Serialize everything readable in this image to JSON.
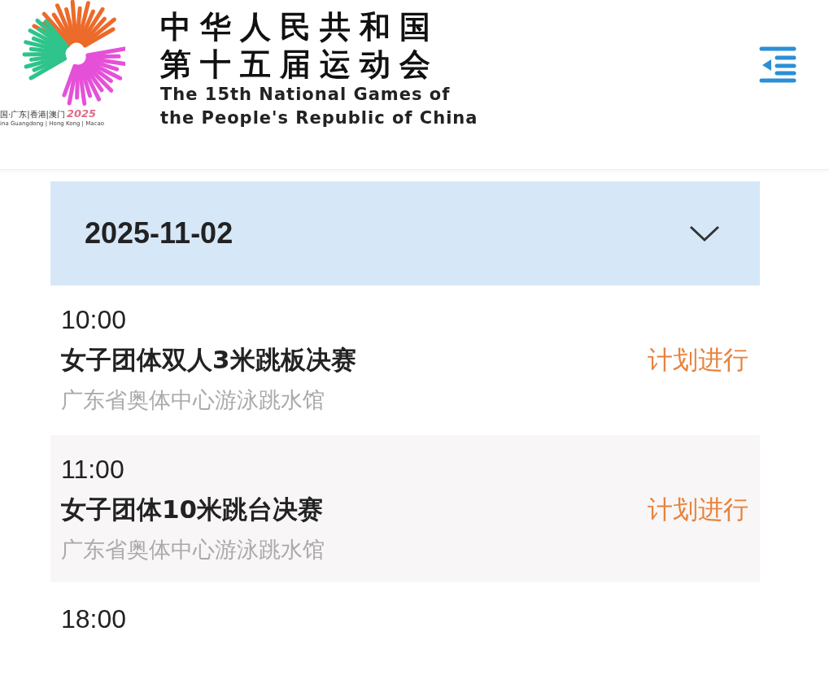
{
  "header": {
    "logo": {
      "region_text": "国·广东|香港|澳门",
      "year": "2025",
      "region_subtitle": "ina Guangdong | Hong Kong | Macao"
    },
    "title_lines": [
      "中华人民共和国",
      "第十五届运动会"
    ],
    "subtitle_lines": [
      "The 15th National Games of",
      "the People's Republic of China"
    ]
  },
  "date_picker": {
    "value": "2025-11-02",
    "expanded": false
  },
  "events": [
    {
      "time": "10:00",
      "title": "女子团体双人3米跳板决赛",
      "venue": "广东省奥体中心游泳跳水馆",
      "status": "计划进行"
    },
    {
      "time": "11:00",
      "title": "女子团体10米跳台决赛",
      "venue": "广东省奥体中心游泳跳水馆",
      "status": "计划进行"
    },
    {
      "time": "18:00"
    }
  ]
}
